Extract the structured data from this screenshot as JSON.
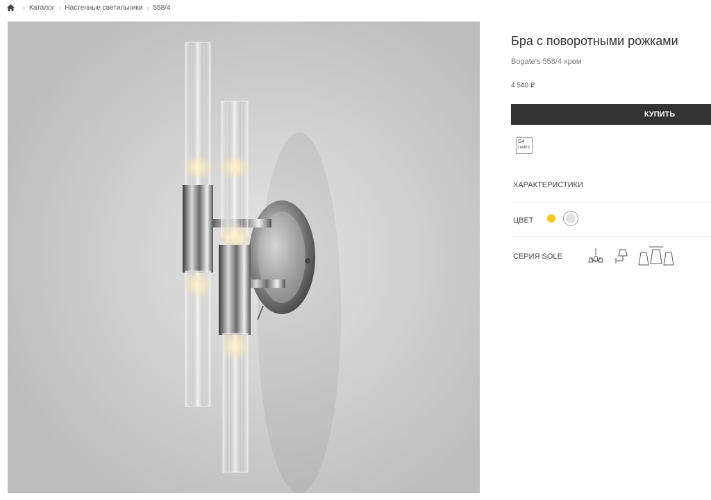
{
  "breadcrumb": {
    "home_icon": "home-icon",
    "items": [
      "Каталог",
      "Настенные светильники",
      "558/4"
    ]
  },
  "product": {
    "title": "Бра с поворотными рожками",
    "subtitle": "Bogate's 558/4 хром",
    "price": "4 540 ₽",
    "buy_label": "КУПИТЬ",
    "lamp_badge": {
      "line1": "G4",
      "line2": "LAMPS"
    }
  },
  "specs": {
    "label": "ХАРАКТЕРИСТИКИ"
  },
  "color": {
    "label": "ЦВЕТ",
    "options": [
      {
        "name": "gold",
        "hex": "#f2c811"
      },
      {
        "name": "chrome",
        "hex": "#dfe3e8"
      }
    ]
  },
  "series": {
    "label": "СЕРИЯ SOLE",
    "icons": [
      "chandelier-icon",
      "wall-lamp-icon",
      "ceiling-lamp-icon"
    ]
  },
  "colors": {
    "button_bg": "#333333",
    "photo_bg": "#c9c9c9"
  }
}
